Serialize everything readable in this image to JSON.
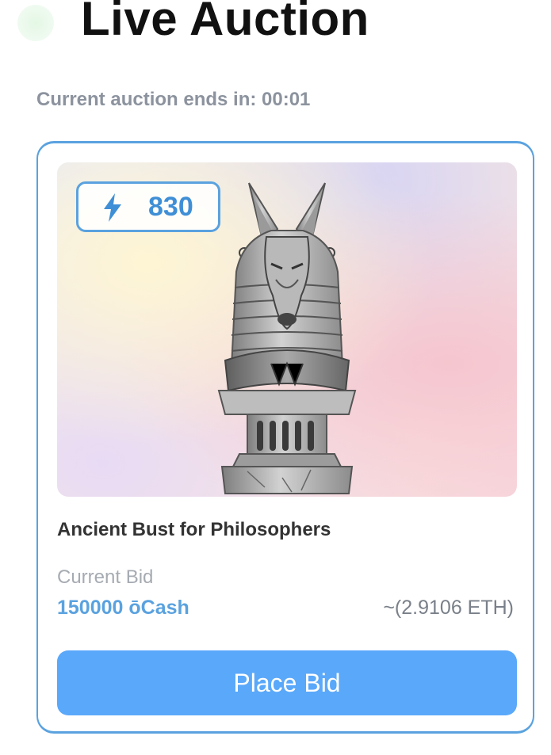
{
  "header": {
    "title": "Live Auction"
  },
  "auction": {
    "countdown_text": "Current auction ends in: 00:01"
  },
  "card": {
    "energy_value": "830",
    "item_title": "Ancient Bust for Philosophers",
    "current_bid_label": "Current Bid",
    "current_bid_amount": "150000 ōCash",
    "current_bid_eth": "~(2.9106 ETH)",
    "button_label": "Place Bid"
  },
  "icons": {
    "energy": "lightning-bolt-icon",
    "live_indicator": "live-dot-icon"
  },
  "colors": {
    "accent": "#5aa2df",
    "button": "#5aa8fa",
    "title": "#111111",
    "muted": "#8c939e"
  }
}
